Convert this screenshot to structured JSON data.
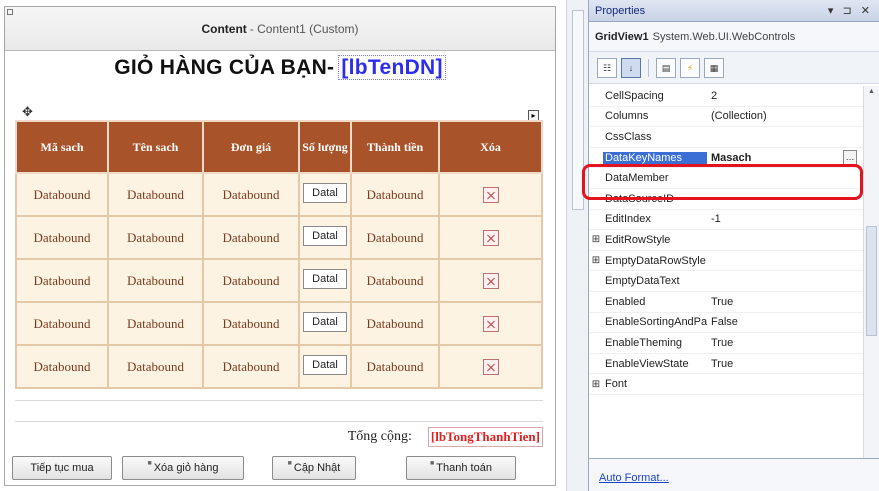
{
  "content_header": {
    "bold": "Content",
    "rest": "- Content1 (Custom)"
  },
  "page_title": {
    "text": "GIỎ HÀNG CỦA BẠN-",
    "label_ref": "[lbTenDN]"
  },
  "grid": {
    "headers": [
      "Mã sach",
      "Tên sach",
      "Đơn giá",
      "Số lượng",
      "Thành tiền",
      "Xóa"
    ],
    "rows": [
      {
        "ma": "Databound",
        "ten": "Databound",
        "gia": "Databound",
        "sl": "Datal",
        "tt": "Databound"
      },
      {
        "ma": "Databound",
        "ten": "Databound",
        "gia": "Databound",
        "sl": "Datal",
        "tt": "Databound"
      },
      {
        "ma": "Databound",
        "ten": "Databound",
        "gia": "Databound",
        "sl": "Datal",
        "tt": "Databound"
      },
      {
        "ma": "Databound",
        "ten": "Databound",
        "gia": "Databound",
        "sl": "Datal",
        "tt": "Databound"
      },
      {
        "ma": "Databound",
        "ten": "Databound",
        "gia": "Databound",
        "sl": "Datal",
        "tt": "Databound"
      }
    ]
  },
  "total": {
    "label": "Tổng cộng:",
    "value": "[lbTongThanhTien]"
  },
  "buttons": {
    "continue": "Tiếp tục mua",
    "clear": "Xóa giỏ hàng",
    "update": "Cập Nhật",
    "checkout": "Thanh toán"
  },
  "props": {
    "title": "Properties",
    "pin_controls": "▾ ⊐ ✕",
    "object_name": "GridView1",
    "object_type": "System.Web.UI.WebControls",
    "rows": [
      {
        "name": "CellSpacing",
        "value": "2",
        "expander": ""
      },
      {
        "name": "Columns",
        "value": "(Collection)",
        "expander": ""
      },
      {
        "name": "CssClass",
        "value": "",
        "expander": ""
      },
      {
        "name": "DataKeyNames",
        "value": "Masach",
        "expander": "",
        "selected": true
      },
      {
        "name": "DataMember",
        "value": "",
        "expander": ""
      },
      {
        "name": "DataSourceID",
        "value": "",
        "expander": ""
      },
      {
        "name": "EditIndex",
        "value": "-1",
        "expander": ""
      },
      {
        "name": "EditRowStyle",
        "value": "",
        "expander": "⊞"
      },
      {
        "name": "EmptyDataRowStyle",
        "value": "",
        "expander": "⊞"
      },
      {
        "name": "EmptyDataText",
        "value": "",
        "expander": ""
      },
      {
        "name": "Enabled",
        "value": "True",
        "expander": ""
      },
      {
        "name": "EnableSortingAndPagingCallbacks",
        "value": "False",
        "expander": ""
      },
      {
        "name": "EnableTheming",
        "value": "True",
        "expander": ""
      },
      {
        "name": "EnableViewState",
        "value": "True",
        "expander": ""
      },
      {
        "name": "Font",
        "value": "",
        "expander": "⊞"
      }
    ],
    "footer_link": "Auto Format..."
  }
}
